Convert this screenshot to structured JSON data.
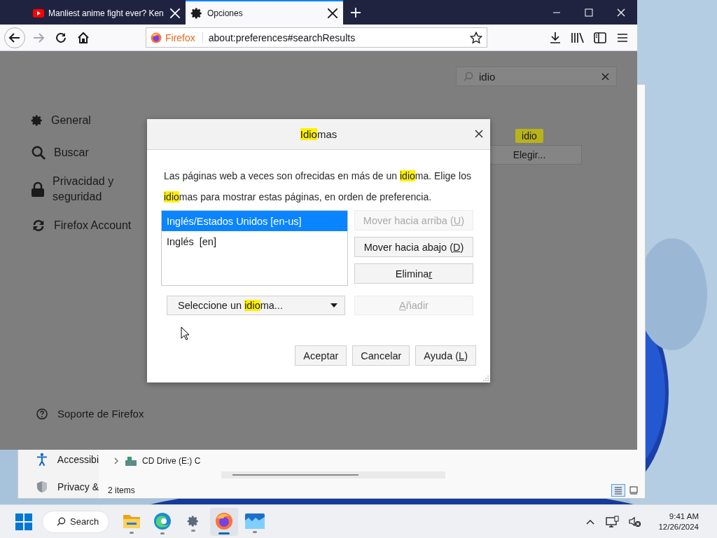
{
  "browser": {
    "tabs": [
      {
        "title": "Manliest anime fight ever? Ken",
        "kind": "video",
        "selected": false
      },
      {
        "title": "Opciones",
        "kind": "gear",
        "selected": true
      }
    ],
    "nav_buttons": [
      {
        "kind": "back",
        "disabled": false
      },
      {
        "kind": "forward",
        "disabled": true
      },
      {
        "kind": "reload",
        "disabled": false
      },
      {
        "kind": "home",
        "disabled": false
      }
    ],
    "url_bar": {
      "identity": "Firefox",
      "value": "about:preferences#searchResults"
    }
  },
  "preferences": {
    "categories": [
      {
        "label": "General",
        "kind": "gear"
      },
      {
        "label": "Buscar",
        "kind": "search"
      },
      {
        "label": "Privacidad y seguridad",
        "kind": "lock"
      },
      {
        "label": "Firefox Account",
        "kind": "sync"
      }
    ],
    "support_link": "Soporte de Firefox",
    "search": {
      "value": "idio"
    },
    "match_badge": "idio",
    "choose_button": "Elegir..."
  },
  "dialog": {
    "title": [
      {
        "text": "Idio",
        "kind": "highlight"
      },
      {
        "text": "mas",
        "kind": "plain"
      }
    ],
    "description": [
      {
        "text": "Las páginas web a veces son ofrecidas en más de un ",
        "kind": "plain"
      },
      {
        "text": "idio",
        "kind": "highlight"
      },
      {
        "text": "ma. Elige los ",
        "kind": "plain"
      },
      {
        "text": "idio",
        "kind": "highlight"
      },
      {
        "text": "mas para mostrar estas páginas, en orden de preferencia.",
        "kind": "plain"
      }
    ],
    "languages": [
      {
        "label": "Inglés/Estados Unidos [en-us]",
        "selected": true
      },
      {
        "label": "Inglés  [en]",
        "selected": false
      }
    ],
    "side_buttons": [
      {
        "label": [
          {
            "text": "Mover hacia arriba (",
            "kind": "plain"
          },
          {
            "text": "U",
            "kind": "underline"
          },
          {
            "text": ")",
            "kind": "plain"
          }
        ],
        "disabled": true
      },
      {
        "label": [
          {
            "text": "Mover hacia abajo (",
            "kind": "plain"
          },
          {
            "text": "D",
            "kind": "underline"
          },
          {
            "text": ")",
            "kind": "plain"
          }
        ],
        "disabled": false
      },
      {
        "label": [
          {
            "text": "Elimina",
            "kind": "plain"
          },
          {
            "text": "r",
            "kind": "underline"
          }
        ],
        "disabled": false
      }
    ],
    "language_select": [
      {
        "text": "Seleccione un ",
        "kind": "plain"
      },
      {
        "text": "idio",
        "kind": "highlight"
      },
      {
        "text": "ma...",
        "kind": "plain"
      }
    ],
    "add_button": {
      "label": [
        {
          "text": "A",
          "kind": "underline"
        },
        {
          "text": "ñadir",
          "kind": "plain"
        }
      ],
      "disabled": true
    },
    "footer_buttons": [
      {
        "label": [
          {
            "text": "Aceptar",
            "kind": "plain"
          }
        ]
      },
      {
        "label": [
          {
            "text": "Cancelar",
            "kind": "plain"
          }
        ]
      },
      {
        "label": [
          {
            "text": "Ayuda (",
            "kind": "plain"
          },
          {
            "text": "L",
            "kind": "underline"
          },
          {
            "text": ")",
            "kind": "plain"
          }
        ]
      }
    ]
  },
  "explorer": {
    "nav_items": [
      {
        "label": "Accessibi",
        "kind": "accessibility"
      },
      {
        "label": "Privacy &",
        "kind": "shield"
      }
    ],
    "tree_items": [
      {
        "label": "CD Drive (E:) C",
        "expanded": false
      }
    ],
    "status": "2 items",
    "views": [
      {
        "kind": "details",
        "selected": true
      },
      {
        "kind": "tiles",
        "selected": false
      }
    ]
  },
  "taskbar": {
    "search": "Search",
    "apps": [
      {
        "kind": "folder",
        "active": false
      },
      {
        "kind": "edge",
        "active": false
      },
      {
        "kind": "settings",
        "active": false
      },
      {
        "kind": "firefox",
        "active": true
      },
      {
        "kind": "gallery",
        "active": false
      }
    ],
    "time": "9:41 AM",
    "date": "12/26/2024"
  }
}
